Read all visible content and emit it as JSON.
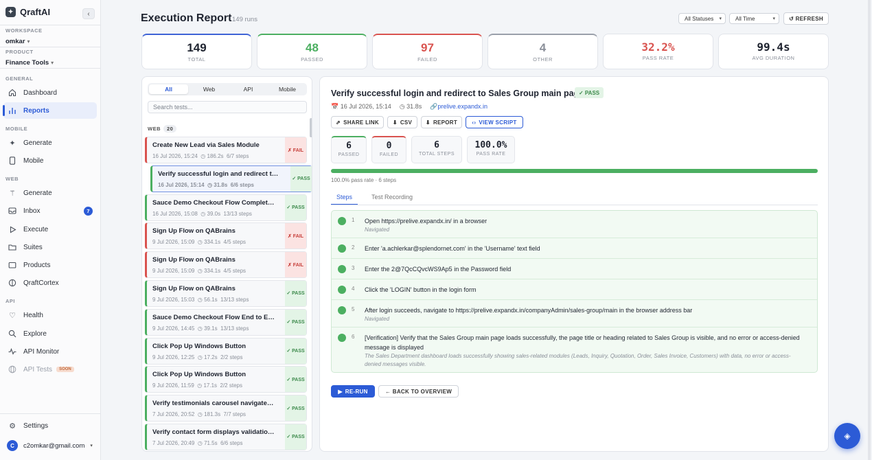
{
  "app": {
    "name": "QraftAI",
    "collapse_icon": "‹"
  },
  "workspace": {
    "label": "WORKSPACE",
    "value": "omkar"
  },
  "product": {
    "label": "PRODUCT",
    "value": "Finance Tools"
  },
  "nav": {
    "general_label": "GENERAL",
    "dashboard": "Dashboard",
    "reports": "Reports",
    "mobile_label": "MOBILE",
    "mobile_generate": "Generate",
    "mobile": "Mobile",
    "web_label": "WEB",
    "web_generate": "Generate",
    "inbox": "Inbox",
    "inbox_count": "7",
    "execute": "Execute",
    "suites": "Suites",
    "products": "Products",
    "qraftcortex": "QraftCortex",
    "api_label": "API",
    "health": "Health",
    "explore": "Explore",
    "api_monitor": "API Monitor",
    "api_tests": "API Tests",
    "soon": "SOON",
    "settings": "Settings"
  },
  "user": {
    "initial": "C",
    "email": "c2omkar@gmail.com"
  },
  "header": {
    "title": "Execution Report",
    "runs": "149 runs",
    "status_filter": "All Statuses",
    "time_filter": "All Time",
    "refresh": "↺ REFRESH"
  },
  "stats": {
    "total": {
      "value": "149",
      "label": "TOTAL"
    },
    "passed": {
      "value": "48",
      "label": "PASSED"
    },
    "failed": {
      "value": "97",
      "label": "FAILED"
    },
    "other": {
      "value": "4",
      "label": "OTHER"
    },
    "pass_rate": {
      "value": "32.2%",
      "label": "PASS RATE"
    },
    "avg_duration": {
      "value": "99.4s",
      "label": "AVG DURATION"
    }
  },
  "list": {
    "tabs": [
      "All",
      "Web",
      "API",
      "Mobile"
    ],
    "search_placeholder": "Search tests...",
    "group": "WEB",
    "group_count": "20",
    "items": [
      {
        "name": "Create New Lead via Sales Module",
        "date": "16 Jul 2026, 15:24",
        "duration": "186.2s",
        "steps": "6/7 steps",
        "status": "✗ FAIL"
      },
      {
        "name": "Verify successful login and redirect to Sales Group main page",
        "date": "16 Jul 2026, 15:14",
        "duration": "31.8s",
        "steps": "6/6 steps",
        "status": "✓ PASS"
      },
      {
        "name": "Sauce Demo Checkout Flow Completion",
        "date": "16 Jul 2026, 15:08",
        "duration": "39.0s",
        "steps": "13/13 steps",
        "status": "✓ PASS"
      },
      {
        "name": "Sign Up Flow on QABrains",
        "date": "9 Jul 2026, 15:09",
        "duration": "334.1s",
        "steps": "4/5 steps",
        "status": "✗ FAIL"
      },
      {
        "name": "Sign Up Flow on QABrains",
        "date": "9 Jul 2026, 15:09",
        "duration": "334.1s",
        "steps": "4/5 steps",
        "status": "✗ FAIL"
      },
      {
        "name": "Sign Up Flow on QABrains",
        "date": "9 Jul 2026, 15:03",
        "duration": "56.1s",
        "steps": "13/13 steps",
        "status": "✓ PASS"
      },
      {
        "name": "Sauce Demo Checkout Flow End to End",
        "date": "9 Jul 2026, 14:45",
        "duration": "39.1s",
        "steps": "13/13 steps",
        "status": "✓ PASS"
      },
      {
        "name": "Click Pop Up Windows Button",
        "date": "9 Jul 2026, 12:25",
        "duration": "17.2s",
        "steps": "2/2 steps",
        "status": "✓ PASS"
      },
      {
        "name": "Click Pop Up Windows Button",
        "date": "9 Jul 2026, 11:59",
        "duration": "17.1s",
        "steps": "2/2 steps",
        "status": "✓ PASS"
      },
      {
        "name": "Verify testimonials carousel navigates correctly",
        "date": "7 Jul 2026, 20:52",
        "duration": "181.3s",
        "steps": "7/7 steps",
        "status": "✓ PASS"
      },
      {
        "name": "Verify contact form displays validation errors",
        "date": "7 Jul 2026, 20:49",
        "duration": "71.5s",
        "steps": "6/6 steps",
        "status": "✓ PASS"
      }
    ]
  },
  "detail": {
    "title": "Verify successful login and redirect to Sales Group main page",
    "status": "✓ PASS",
    "date": "16 Jul 2026, 15:14",
    "duration": "31.8s",
    "link": "prelive.expandx.in",
    "actions": {
      "share": "SHARE LINK",
      "csv": "CSV",
      "report": "REPORT",
      "script": "VIEW SCRIPT"
    },
    "metrics": {
      "passed": {
        "value": "6",
        "label": "PASSED"
      },
      "failed": {
        "value": "0",
        "label": "FAILED"
      },
      "total": {
        "value": "6",
        "label": "TOTAL STEPS"
      },
      "rate": {
        "value": "100.0%",
        "label": "PASS RATE"
      }
    },
    "progress": 1.0,
    "progress_label": "100.0% pass rate · 6 steps",
    "tabs": [
      "Steps",
      "Test Recording"
    ],
    "steps": [
      {
        "num": "1",
        "text": "Open https://prelive.expandx.in/ in a browser",
        "sub": "Navigated"
      },
      {
        "num": "2",
        "text": "Enter 'a.achlerkar@splendornet.com' in the 'Username' text field",
        "sub": ""
      },
      {
        "num": "3",
        "text": "Enter the 2@7QcCQvcWS9Ap5 in the Password field",
        "sub": ""
      },
      {
        "num": "4",
        "text": "Click the 'LOGIN' button in the login form",
        "sub": ""
      },
      {
        "num": "5",
        "text": "After login succeeds, navigate to https://prelive.expandx.in/companyAdmin/sales-group/main in the browser address bar",
        "sub": "Navigated"
      },
      {
        "num": "6",
        "text": "[Verification] Verify that the Sales Group main page loads successfully, the page title or heading related to Sales Group is visible, and no error or access-denied message is displayed",
        "sub": "The Sales Department dashboard loads successfully showing sales-related modules (Leads, Inquiry, Quotation, Order, Sales Invoice, Customers) with data, no error or access-denied messages visible."
      }
    ],
    "rerun": "RE-RUN",
    "back": "← BACK TO OVERVIEW"
  },
  "colors": {
    "accent": "#2c5bd6",
    "pass": "#4caf61",
    "fail": "#d9534f"
  }
}
